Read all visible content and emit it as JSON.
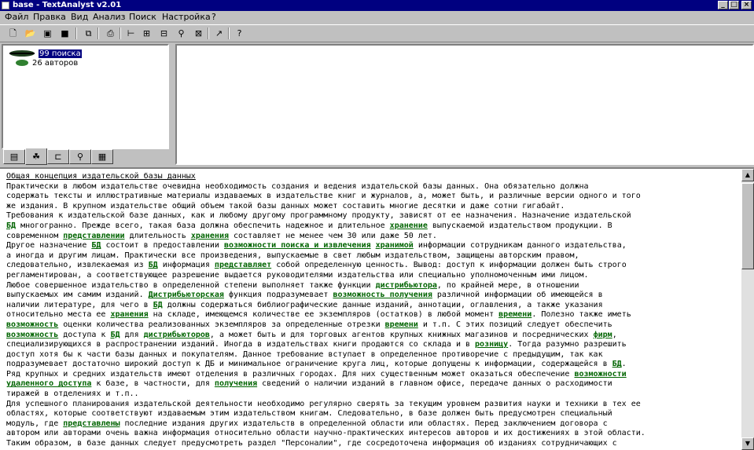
{
  "window": {
    "title": "base - TextAnalyst v2.01",
    "icon": "app-icon"
  },
  "menu": [
    "Файл",
    "Правка",
    "Вид",
    "Анализ",
    "Поиск",
    "Настройка",
    "?"
  ],
  "toolbar": {
    "icons": [
      "new-icon",
      "open-icon",
      "open-base-icon",
      "save-icon",
      "copy-icon",
      "print-icon",
      "tree-icon",
      "network-icon",
      "summary-icon",
      "search-icon",
      "compare-icon",
      "export-icon",
      "help-icon"
    ]
  },
  "tree": {
    "items": [
      {
        "label": "99 поиска",
        "selected": true,
        "icon": "search-results-icon"
      },
      {
        "label": "26 авторов",
        "selected": false,
        "icon": "authors-icon"
      }
    ]
  },
  "tabs": [
    {
      "icon": "document-tab-icon",
      "active": false
    },
    {
      "icon": "tree-tab-icon",
      "active": true
    },
    {
      "icon": "structure-tab-icon",
      "active": false
    },
    {
      "icon": "search-tab-icon",
      "active": false
    },
    {
      "icon": "summary-tab-icon",
      "active": false
    }
  ],
  "document": {
    "heading": "Общая концепция издательской базы данных",
    "lines": [
      [
        "Практически в любом издательстве очевидна необходимость создания и ведения издательской базы данных. Она обязательно должна"
      ],
      [
        "содержать тексты и иллюстративные материалы издаваемых в издательстве книг и журналов, а, может быть, и различные версии одного и того"
      ],
      [
        "же издания. В крупном издательстве общий объем такой базы данных может составить многие десятки и даже сотни гигабайт."
      ],
      [
        "Требования к издательской базе данных, как и любому другому программному продукту, зависят от ее назначения. Назначение издательской"
      ],
      [
        {
          "h": "БД"
        },
        " многогранно. Прежде всего, такая база должна обеспечить надежное и длительное ",
        {
          "h": "хранение"
        },
        " выпускаемой издательством продукции. В"
      ],
      [
        "современном ",
        {
          "h": "представлении"
        },
        " длительность ",
        {
          "h": "хранения"
        },
        " составляет не менее чем 30 или даже 50 лет."
      ],
      [
        "Другое назначение ",
        {
          "h": "БД"
        },
        " состоит в предоставлении ",
        {
          "h": "возможности поиска и извлечения"
        },
        " ",
        {
          "h": "хранимой"
        },
        " информации сотрудникам данного издательства,"
      ],
      [
        "а иногда и другим лицам. Практически все произведения, выпускаемые в свет любым издательством, защищены авторским правом,"
      ],
      [
        "следовательно, извлекаемая из ",
        {
          "h": "БД"
        },
        " информация ",
        {
          "h": "представляет"
        },
        " собой определенную ценность. Вывод: доступ к информации должен быть строго"
      ],
      [
        "регламентирован, а соответствующее разрешение выдается руководителями издательства или специально уполномоченным ими лицом."
      ],
      [
        "Любое совершенное издательство в определенной степени выполняет также функции ",
        {
          "h": "дистрибьютора"
        },
        ", по крайней мере, в отношении"
      ],
      [
        "выпускаемых им самим изданий. ",
        {
          "h": "Дистрибьюторская"
        },
        " функция подразумевает ",
        {
          "h": "возможность получения"
        },
        " различной информации об имеющейся в"
      ],
      [
        "наличии литературе, для чего в ",
        {
          "h": "БД"
        },
        " должны содержаться библиографические данные изданий, аннотации, оглавления, а также указания"
      ],
      [
        "относительно места ее ",
        {
          "h": "хранения"
        },
        " на складе, имеющемся количестве ее экземпляров (остатков) в любой момент ",
        {
          "h": "времени"
        },
        ". Полезно также иметь"
      ],
      [
        {
          "h": "возможность"
        },
        " оценки количества реализованных экземпляров за определенные отрезки ",
        {
          "h": "времени"
        },
        " и т.п. С этих позиций следует обеспечить"
      ],
      [
        {
          "h": "возможность"
        },
        " доступа к ",
        {
          "h": "БД"
        },
        " для ",
        {
          "h": "дистрибьюторов"
        },
        ", а может быть и для торговых агентов крупных книжных магазинов и посреднических ",
        {
          "h": "фирм"
        },
        ","
      ],
      [
        "специализирующихся в распространении изданий. Иногда в издательствах книги продаются со склада и в ",
        {
          "h": "розницу"
        },
        ". Тогда разумно разрешить"
      ],
      [
        "доступ хотя бы к части базы данных и покупателям. Данное требование вступает в определенное противоречие с предыдущим, так как"
      ],
      [
        "подразумевает достаточно широкий доступ к ДБ и минимальное ограничение круга лиц, которые допущены к информации, содержащейся в ",
        {
          "h": "БД"
        },
        "."
      ],
      [
        "Ряд крупных и средних издательств имеют отделения в различных городах. Для них существенным может оказаться обеспечение ",
        {
          "h": "возможности"
        }
      ],
      [
        {
          "h": "удаленного доступа"
        },
        " к базе, в частности, для ",
        {
          "h": "получения"
        },
        " сведений о наличии изданий в главном офисе, передаче данных о расходимости"
      ],
      [
        "тиражей в отделениях и т.п.."
      ],
      [
        "Для успешного планирования издательской деятельности необходимо регулярно сверять за текущим уровнем развития науки и техники в тех ее"
      ],
      [
        "областях, которые соответствуют издаваемым этим издательством книгам. Следовательно, в базе должен быть предусмотрен специальный"
      ],
      [
        "модуль, где ",
        {
          "h": "представлены"
        },
        " последние издания других издательств в определенной области или областях. Перед заключением договора с"
      ],
      [
        "автором или авторами очень важна информация относительно области научно-практических интересов авторов и их достижениях в этой области."
      ],
      [
        "Таким образом, в базе данных следует предусмотреть раздел \"Персоналии\", где сосредоточена информация об изданиях сотрудничающих с"
      ]
    ]
  },
  "colors": {
    "titlebar": "#000080",
    "highlight": "#006400",
    "face": "#c0c0c0"
  }
}
